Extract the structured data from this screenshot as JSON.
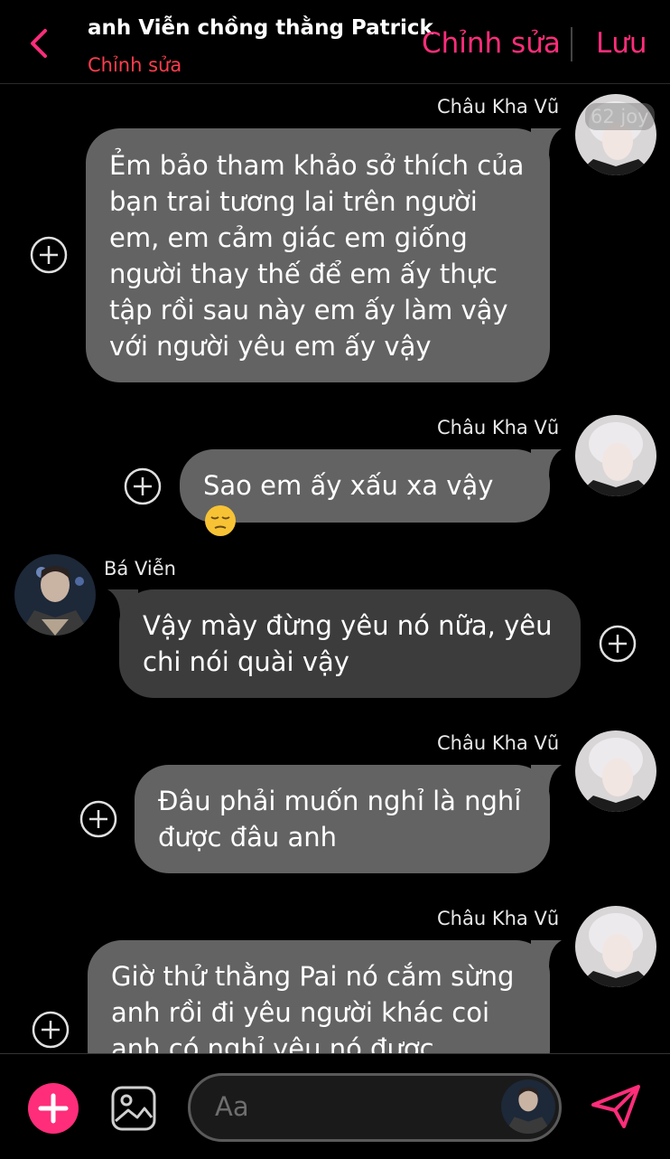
{
  "header": {
    "title": "anh Viễn chồng thằng Patrick",
    "subtitle": "Chỉnh sửa",
    "edit_label": "Chỉnh sửa",
    "save_label": "Lưu"
  },
  "messages": [
    {
      "sender": "Châu Kha Vũ",
      "side": "right",
      "lines": [
        "Ẻm bảo tham khảo sở thích của",
        "bạn trai tương lai trên người",
        "em, em cảm giác em giống",
        "người thay thế để em ấy thực",
        "tập rồi sau này em ấy làm vậy",
        "với người yêu em ấy vậy"
      ],
      "badge": "62 joy"
    },
    {
      "sender": "Châu Kha Vũ",
      "side": "right",
      "lines": [
        "Sao em ấy xấu xa vậy"
      ]
    },
    {
      "sender": "Bá Viễn",
      "side": "left",
      "lines": [
        "Vậy mày đừng yêu nó nữa, yêu",
        "chi nói quài vậy"
      ]
    },
    {
      "sender": "Châu Kha Vũ",
      "side": "right",
      "lines": [
        "Đâu phải muốn nghỉ là nghỉ",
        "được đâu anh"
      ]
    },
    {
      "sender": "Châu Kha Vũ",
      "side": "right",
      "lines": [
        "Giờ thử thằng Pai nó cắm sừng",
        "anh rồi đi yêu người khác coi",
        "anh có nghỉ yêu nó được"
      ]
    }
  ],
  "composer": {
    "placeholder": "Aa"
  },
  "colors": {
    "accent": "#ff2d7a",
    "subtitle": "#ff3d4e",
    "bubble_right": "#636363",
    "bubble_left": "#3c3c3c"
  },
  "icons": [
    "chevron-left-icon",
    "plus-circle-icon",
    "pensive-emoji-icon",
    "add-icon",
    "image-icon",
    "send-icon"
  ]
}
